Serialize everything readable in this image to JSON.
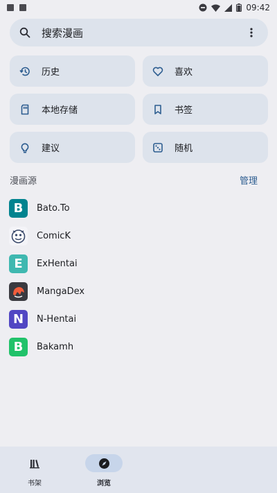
{
  "status_bar": {
    "time": "09:42"
  },
  "search": {
    "placeholder": "搜索漫画"
  },
  "quick_actions": [
    {
      "label": "历史",
      "icon": "history-icon"
    },
    {
      "label": "喜欢",
      "icon": "heart-icon"
    },
    {
      "label": "本地存储",
      "icon": "storage-icon"
    },
    {
      "label": "书签",
      "icon": "bookmark-icon"
    },
    {
      "label": "建议",
      "icon": "lightbulb-icon"
    },
    {
      "label": "随机",
      "icon": "dice-icon"
    }
  ],
  "sources_section": {
    "title": "漫画源",
    "action": "管理"
  },
  "sources": [
    {
      "name": "Bato.To",
      "logo_letter": "B",
      "color": "#00838f"
    },
    {
      "name": "ComicK",
      "logo_letter": "",
      "color": "#3b4a6b"
    },
    {
      "name": "ExHentai",
      "logo_letter": "E",
      "color": "#3fb8b0"
    },
    {
      "name": "MangaDex",
      "logo_letter": "",
      "color": "#f25d3b"
    },
    {
      "name": "N-Hentai",
      "logo_letter": "N",
      "color": "#5146c3"
    },
    {
      "name": "Bakamh",
      "logo_letter": "B",
      "color": "#21c26a"
    }
  ],
  "bottom_nav": [
    {
      "label": "书架",
      "icon": "library-icon"
    },
    {
      "label": "浏览",
      "icon": "compass-icon"
    },
    {
      "label": "",
      "icon": "blank"
    },
    {
      "label": "",
      "icon": "blank"
    }
  ]
}
